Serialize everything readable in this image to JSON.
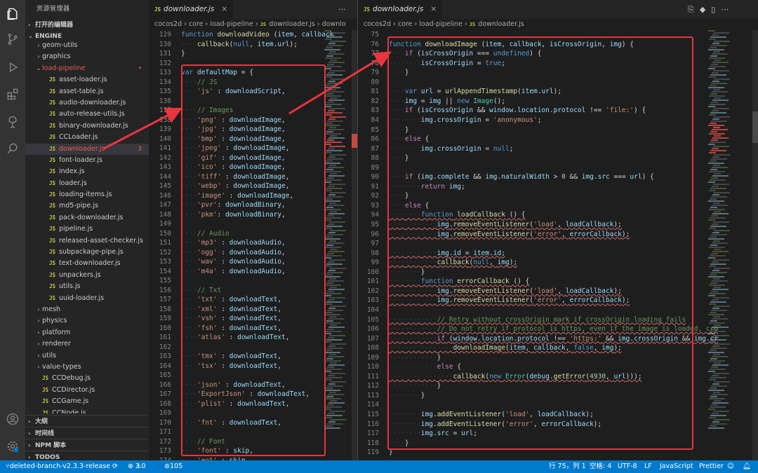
{
  "explorer": {
    "title": "资源管理器",
    "open_editors": "打开的编辑器",
    "root": "ENGINE",
    "items": [
      {
        "label": "geom-utils",
        "type": "folder",
        "depth": 1,
        "open": false
      },
      {
        "label": "graphics",
        "type": "folder",
        "depth": 1,
        "open": false
      },
      {
        "label": "load-pipeline",
        "type": "folder",
        "depth": 1,
        "open": true,
        "modified": true
      },
      {
        "label": "asset-loader.js",
        "type": "js",
        "depth": 2
      },
      {
        "label": "asset-table.js",
        "type": "js",
        "depth": 2
      },
      {
        "label": "audio-downloader.js",
        "type": "js",
        "depth": 2
      },
      {
        "label": "auto-release-utils.js",
        "type": "js",
        "depth": 2
      },
      {
        "label": "binary-downloader.js",
        "type": "js",
        "depth": 2
      },
      {
        "label": "CCLoader.js",
        "type": "js",
        "depth": 2
      },
      {
        "label": "downloader.js",
        "type": "js",
        "depth": 2,
        "selected": true,
        "badge": "3"
      },
      {
        "label": "font-loader.js",
        "type": "js",
        "depth": 2
      },
      {
        "label": "index.js",
        "type": "js",
        "depth": 2
      },
      {
        "label": "loader.js",
        "type": "js",
        "depth": 2
      },
      {
        "label": "loading-items.js",
        "type": "js",
        "depth": 2
      },
      {
        "label": "md5-pipe.js",
        "type": "js",
        "depth": 2
      },
      {
        "label": "pack-downloader.js",
        "type": "js",
        "depth": 2
      },
      {
        "label": "pipeline.js",
        "type": "js",
        "depth": 2
      },
      {
        "label": "released-asset-checker.js",
        "type": "js",
        "depth": 2
      },
      {
        "label": "subpackage-pipe.js",
        "type": "js",
        "depth": 2
      },
      {
        "label": "text-downloader.js",
        "type": "js",
        "depth": 2
      },
      {
        "label": "unpackers.js",
        "type": "js",
        "depth": 2
      },
      {
        "label": "utils.js",
        "type": "js",
        "depth": 2
      },
      {
        "label": "uuid-loader.js",
        "type": "js",
        "depth": 2
      },
      {
        "label": "mesh",
        "type": "folder",
        "depth": 1,
        "open": false
      },
      {
        "label": "physics",
        "type": "folder",
        "depth": 1,
        "open": false
      },
      {
        "label": "platform",
        "type": "folder",
        "depth": 1,
        "open": false
      },
      {
        "label": "renderer",
        "type": "folder",
        "depth": 1,
        "open": false
      },
      {
        "label": "utils",
        "type": "folder",
        "depth": 1,
        "open": false
      },
      {
        "label": "value-types",
        "type": "folder",
        "depth": 1,
        "open": false
      },
      {
        "label": "CCDebug.js",
        "type": "js",
        "depth": 1
      },
      {
        "label": "CCDirector.js",
        "type": "js",
        "depth": 1
      },
      {
        "label": "CCGame.js",
        "type": "js",
        "depth": 1
      },
      {
        "label": "CCNode.js",
        "type": "js",
        "depth": 1
      }
    ],
    "bottom_sections": [
      "大纲",
      "时间线",
      "NPM 脚本",
      "TODOS"
    ]
  },
  "left_editor": {
    "tab_title": "downloader.js",
    "tab_icon": "JS",
    "breadcrumb": [
      "cocos2d",
      "core",
      "load-pipeline",
      "downloader.js",
      "downlo"
    ],
    "lines": [
      {
        "n": "129",
        "t": "function downloadVideo (item, callback"
      },
      {
        "n": "130",
        "t": "    callback(null, item.url);"
      },
      {
        "n": "131",
        "t": "}"
      },
      {
        "n": "132",
        "t": ""
      },
      {
        "n": "133",
        "t": "var defaultMap = {"
      },
      {
        "n": "134",
        "t": "    // JS"
      },
      {
        "n": "135",
        "t": "    'js' : downloadScript,"
      },
      {
        "n": "136",
        "t": ""
      },
      {
        "n": "137",
        "t": "    // Images"
      },
      {
        "n": "138",
        "t": "    'png' : downloadImage,"
      },
      {
        "n": "139",
        "t": "    'jpg' : downloadImage,"
      },
      {
        "n": "140",
        "t": "    'bmp' : downloadImage,"
      },
      {
        "n": "141",
        "t": "    'jpeg' : downloadImage,"
      },
      {
        "n": "142",
        "t": "    'gif' : downloadImage,"
      },
      {
        "n": "143",
        "t": "    'ico' : downloadImage,"
      },
      {
        "n": "144",
        "t": "    'tiff' : downloadImage,"
      },
      {
        "n": "145",
        "t": "    'webp' : downloadImage,"
      },
      {
        "n": "146",
        "t": "    'image' : downloadImage,"
      },
      {
        "n": "147",
        "t": "    'pvr': downloadBinary,"
      },
      {
        "n": "148",
        "t": "    'pkm': downloadBinary,"
      },
      {
        "n": "149",
        "t": ""
      },
      {
        "n": "150",
        "t": "    // Audio"
      },
      {
        "n": "151",
        "t": "    'mp3' : downloadAudio,"
      },
      {
        "n": "152",
        "t": "    'ogg' : downloadAudio,"
      },
      {
        "n": "153",
        "t": "    'wav' : downloadAudio,"
      },
      {
        "n": "154",
        "t": "    'm4a' : downloadAudio,"
      },
      {
        "n": "155",
        "t": ""
      },
      {
        "n": "156",
        "t": "    // Txt"
      },
      {
        "n": "157",
        "t": "    'txt' : downloadText,"
      },
      {
        "n": "158",
        "t": "    'xml' : downloadText,"
      },
      {
        "n": "159",
        "t": "    'vsh' : downloadText,"
      },
      {
        "n": "160",
        "t": "    'fsh' : downloadText,"
      },
      {
        "n": "161",
        "t": "    'atlas' : downloadText,"
      },
      {
        "n": "162",
        "t": ""
      },
      {
        "n": "163",
        "t": "    'tmx' : downloadText,"
      },
      {
        "n": "164",
        "t": "    'tsx' : downloadText,"
      },
      {
        "n": "165",
        "t": ""
      },
      {
        "n": "166",
        "t": "    'json' : downloadText,"
      },
      {
        "n": "167",
        "t": "    'ExportJson' : downloadText,"
      },
      {
        "n": "168",
        "t": "    'plist' : downloadText,"
      },
      {
        "n": "169",
        "t": ""
      },
      {
        "n": "170",
        "t": "    'fnt' : downloadText,"
      },
      {
        "n": "171",
        "t": ""
      },
      {
        "n": "172",
        "t": "    // Font"
      },
      {
        "n": "173",
        "t": "    'font' : skip,"
      },
      {
        "n": "174",
        "t": "    'eot' : skip,"
      }
    ]
  },
  "right_editor": {
    "tab_title": "downloader.js",
    "tab_icon": "JS",
    "breadcrumb": [
      "cocos2d",
      "core",
      "load-pipeline",
      "downloader.js"
    ],
    "lines": [
      {
        "n": "75",
        "t": ""
      },
      {
        "n": "76",
        "t": "function downloadImage (item, callback, isCrossOrigin, img) {"
      },
      {
        "n": "77",
        "t": "    if (isCrossOrigin === undefined) {"
      },
      {
        "n": "78",
        "t": "        isCrossOrigin = true;"
      },
      {
        "n": "79",
        "t": "    }"
      },
      {
        "n": "80",
        "t": ""
      },
      {
        "n": "81",
        "t": "    var url = urlAppendTimestamp(item.url);"
      },
      {
        "n": "82",
        "t": "    img = img || new Image();"
      },
      {
        "n": "83",
        "t": "    if (isCrossOrigin && window.location.protocol !== 'file:') {"
      },
      {
        "n": "84",
        "t": "        img.crossOrigin = 'anonymous';"
      },
      {
        "n": "85",
        "t": "    }"
      },
      {
        "n": "86",
        "t": "    else {"
      },
      {
        "n": "87",
        "t": "        img.crossOrigin = null;"
      },
      {
        "n": "88",
        "t": "    }"
      },
      {
        "n": "89",
        "t": ""
      },
      {
        "n": "90",
        "t": "    if (img.complete && img.naturalWidth > 0 && img.src === url) {"
      },
      {
        "n": "91",
        "t": "        return img;"
      },
      {
        "n": "92",
        "t": "    }"
      },
      {
        "n": "93",
        "t": "    else {"
      },
      {
        "n": "94",
        "t": "        function loadCallback () {"
      },
      {
        "n": "95",
        "t": "            img.removeEventListener('load', loadCallback);"
      },
      {
        "n": "96",
        "t": "            img.removeEventListener('error', errorCallback);"
      },
      {
        "n": "97",
        "t": ""
      },
      {
        "n": "98",
        "t": "            img.id = item.id;"
      },
      {
        "n": "99",
        "t": "            callback(null, img);"
      },
      {
        "n": "100",
        "t": "        }"
      },
      {
        "n": "101",
        "t": "        function errorCallback () {"
      },
      {
        "n": "102",
        "t": "            img.removeEventListener('load', loadCallback);"
      },
      {
        "n": "103",
        "t": "            img.removeEventListener('error', errorCallback);"
      },
      {
        "n": "104",
        "t": ""
      },
      {
        "n": "105",
        "t": "            // Retry without crossOrigin mark if crossOrigin loading fails"
      },
      {
        "n": "106",
        "t": "            // Do not retry if protocol is https, even if the image is loaded, cro"
      },
      {
        "n": "107",
        "t": "            if (window.location.protocol !== 'https:' && img.crossOrigin && img.cr"
      },
      {
        "n": "108",
        "t": "                downloadImage(item, callback, false, img);"
      },
      {
        "n": "109",
        "t": "            }"
      },
      {
        "n": "110",
        "t": "            else {"
      },
      {
        "n": "111",
        "t": "                callback(new Error(debug.getError(4930, url)));"
      },
      {
        "n": "112",
        "t": "            }"
      },
      {
        "n": "113",
        "t": "        }"
      },
      {
        "n": "114",
        "t": ""
      },
      {
        "n": "115",
        "t": "        img.addEventListener('load', loadCallback);"
      },
      {
        "n": "116",
        "t": "        img.addEventListener('error', errorCallback);"
      },
      {
        "n": "117",
        "t": "        img.src = url;"
      },
      {
        "n": "118",
        "t": "    }"
      },
      {
        "n": "119",
        "t": "}"
      }
    ]
  },
  "statusbar": {
    "branch": "deleted-branch-v2.3.3-release",
    "errors": "3",
    "warnings": "0",
    "ports": "105",
    "position": "行 75，列 1",
    "spaces": "空格: 4",
    "encoding": "UTF-8",
    "eol": "LF",
    "language": "JavaScript",
    "formatter": "Prettier"
  },
  "colors": {
    "accent": "#007acc",
    "annotation": "#e8353e",
    "activity_bar": "#333333",
    "sidebar": "#252526",
    "editor": "#1e1e1e"
  },
  "activity_icons": [
    "files-icon",
    "source-control-icon",
    "run-debug-icon",
    "extensions-icon",
    "remote-icon",
    "search-icon",
    "account-icon",
    "settings-icon"
  ]
}
